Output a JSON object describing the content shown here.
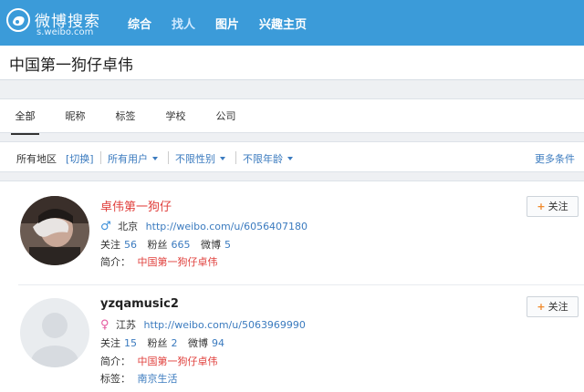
{
  "header": {
    "logo_text": "微博搜索",
    "logo_sub": "s.weibo.com",
    "nav": [
      {
        "label": "综合",
        "active": false
      },
      {
        "label": "找人",
        "active": true
      },
      {
        "label": "图片",
        "active": false
      },
      {
        "label": "兴趣主页",
        "active": false
      }
    ]
  },
  "search": {
    "value": "中国第一狗仔卓伟"
  },
  "tabs": [
    {
      "label": "全部",
      "active": true
    },
    {
      "label": "昵称",
      "active": false
    },
    {
      "label": "标签",
      "active": false
    },
    {
      "label": "学校",
      "active": false
    },
    {
      "label": "公司",
      "active": false
    }
  ],
  "filters": {
    "region_label": "所有地区",
    "switch_label": "[切换]",
    "users_label": "所有用户",
    "gender_label": "不限性别",
    "age_label": "不限年龄",
    "more_label": "更多条件"
  },
  "results": [
    {
      "name": "卓伟第一狗仔",
      "gender": "male",
      "gender_icon": "♂",
      "location": "北京",
      "url": "http://weibo.com/u/6056407180",
      "follow_label": "关注",
      "follow_count": "56",
      "fans_label": "粉丝",
      "fans_count": "665",
      "weibo_label": "微博",
      "weibo_count": "5",
      "bio_label": "简介：",
      "bio": "中国第一狗仔卓伟",
      "button": "关注"
    },
    {
      "name": "yzqamusic2",
      "gender": "female",
      "gender_icon": "♀",
      "location": "江苏",
      "url": "http://weibo.com/u/5063969990",
      "follow_label": "关注",
      "follow_count": "15",
      "fans_label": "粉丝",
      "fans_count": "2",
      "weibo_label": "微博",
      "weibo_count": "94",
      "bio_label": "简介：",
      "bio": "中国第一狗仔卓伟",
      "tag_label": "标签：",
      "tag": "南京生活",
      "button": "关注"
    }
  ],
  "colors": {
    "header_bg": "#3b9bd9",
    "link": "#3b7bbf",
    "accent_red": "#e0403d",
    "plus_orange": "#f08a2c"
  }
}
